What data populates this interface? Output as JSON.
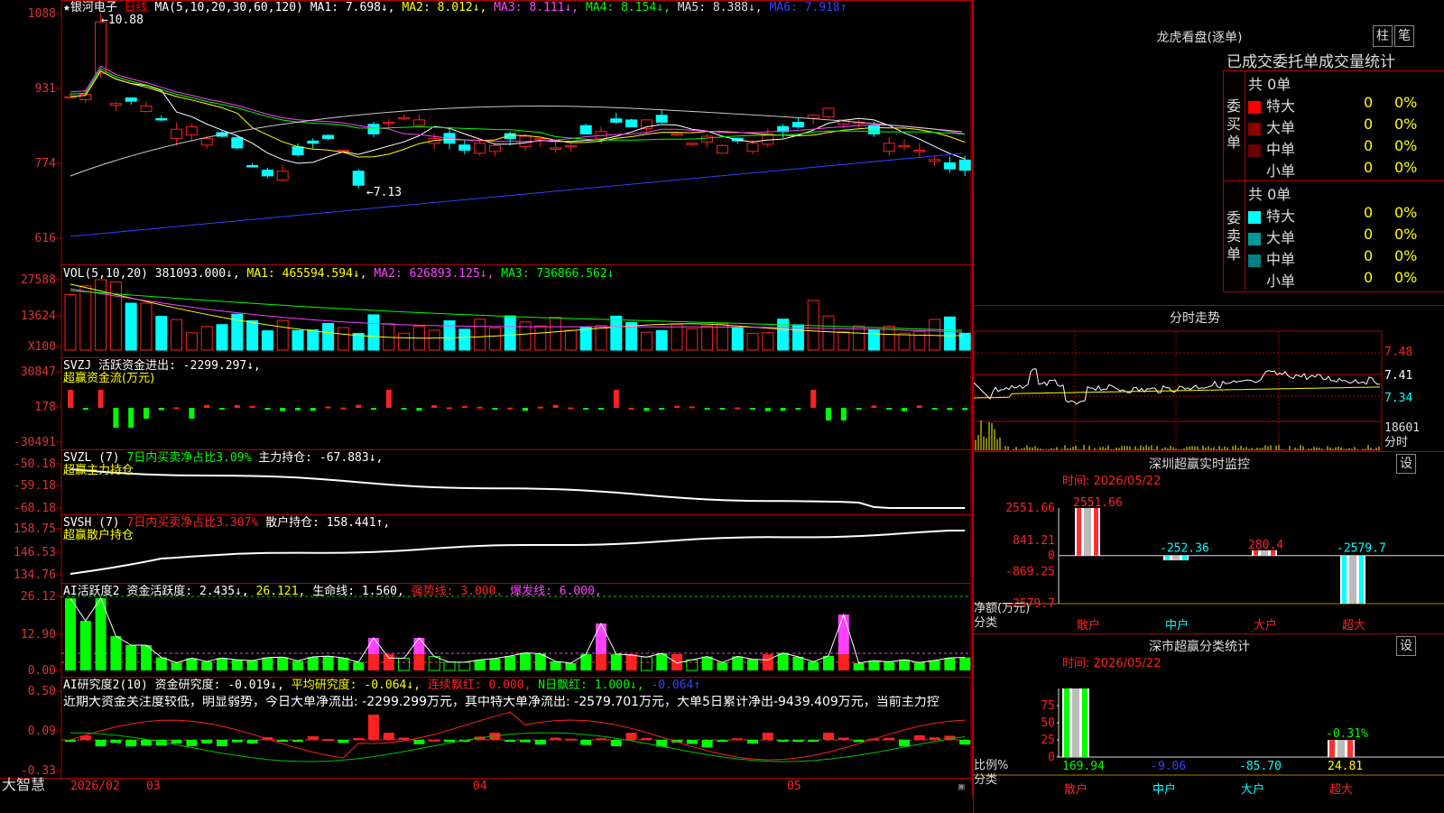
{
  "app": {
    "brand": "大智慧",
    "date_start": "2026/02"
  },
  "main": {
    "title_star": "★",
    "stock_name": "银河电子",
    "period": "日线",
    "ma_def": "MA(5,10,20,30,60,120)",
    "ma1": "MA1: 7.698↓,",
    "ma2": "MA2: 8.012↓,",
    "ma3": "MA3: 8.111↓,",
    "ma4": "MA4: 8.154↓,",
    "ma5": "MA5: 8.388↓,",
    "ma6": "MA6: 7.918↑",
    "high_mark": "10.88",
    "low_mark": "7.13",
    "y_ticks": [
      "1088",
      "931",
      "774",
      "616"
    ]
  },
  "vol": {
    "label": "VOL(5,10,20)",
    "v": "381093.000↓,",
    "ma1": "MA1: 465594.594↓,",
    "ma2": "MA2: 626893.125↓,",
    "ma3": "MA3: 736866.562↓",
    "y_ticks": [
      "27588",
      "13624",
      "X100"
    ]
  },
  "svzj": {
    "label": "SVZJ",
    "text": "活跃资金进出: -2299.297↓,",
    "sub": "超赢资金流(万元)",
    "y_ticks": [
      "30847",
      "178",
      "-30491"
    ]
  },
  "svzl": {
    "label": "SVZL (7)",
    "t1": "7日内买卖净占比3.09%",
    "t2": "主力持仓: -67.883↓,",
    "sub": "超赢主力持仓",
    "y_ticks": [
      "-50.18",
      "-59.18",
      "-68.18"
    ]
  },
  "svsh": {
    "label": "SVSH (7)",
    "t1": "7日内买卖净占比3.307%",
    "t2": "散户持仓: 158.441↑,",
    "sub": "超赢散户持仓",
    "y_ticks": [
      "158.75",
      "146.53",
      "134.76"
    ]
  },
  "ai1": {
    "label": "AI活跃度2",
    "t1": "资金活跃度: 2.435↓,",
    "t2": "26.121,",
    "t3": "生命线: 1.560,",
    "t4": "强势线: 3.000,",
    "t5": "爆发线: 6.000,",
    "y_ticks": [
      "26.12",
      "12.90",
      "0.00"
    ]
  },
  "ai2": {
    "label": "AI研究度2(10)",
    "t1": "资金研究度: -0.019↓,",
    "t2": "平均研究度: -0.064↓,",
    "t3": "连续飘红: 0.000,",
    "t4": "N日飘红: 1.000↓,",
    "t5": "-0.064↑",
    "comment": "近期大资金关注度较低，明显弱势，今日大单净流出: -2299.299万元，其中特大单净流出: -2579.701万元，大单5日累计净出-9439.409万元，当前主力控",
    "y_ticks": [
      "0.50",
      "0.09",
      "-0.33"
    ]
  },
  "axis_months": [
    "03",
    "04",
    "05"
  ],
  "lhb": {
    "title": "龙虎看盘(逐单)",
    "btn1": "柱",
    "btn2": "笔",
    "header": "已成交委托单成交量统计",
    "buy_label": "委买单",
    "sell_label": "委卖单",
    "buy_total": "共 0单",
    "sell_total": "共 0单",
    "rows": [
      "特大",
      "大单",
      "中单",
      "小单"
    ],
    "zero": "0",
    "pct": "0%",
    "buy_colors": [
      "#ff0000",
      "#8b0000",
      "#6a0000",
      ""
    ],
    "sell_colors": [
      "#00ffff",
      "#009999",
      "#008080",
      ""
    ]
  },
  "fenshi": {
    "title": "分时走势",
    "y_ticks": [
      "7.48",
      "7.41",
      "7.34"
    ],
    "vol_tick": "18601",
    "vol_unit": "分时"
  },
  "szm": {
    "title": "深圳超赢实时监控",
    "settings": "设",
    "time": "时间: 2026/05/22",
    "y_ticks": [
      "2551.66",
      "841.21",
      "0",
      "-869.25",
      "-2579.7"
    ],
    "y_title": "净额(万元)",
    "x_title": "分类"
  },
  "szc": {
    "title": "深市超赢分类统计",
    "settings": "设",
    "time": "时间: 2026/05/22",
    "y_ticks": [
      "75",
      "50",
      "25",
      "0"
    ],
    "y_title": "比例%",
    "x_title": "分类"
  },
  "chart_data": [
    {
      "type": "bar",
      "title": "深圳超赢实时监控",
      "ylabel": "净额(万元)",
      "categories": [
        "散户",
        "中户",
        "大户",
        "超大"
      ],
      "values": [
        2551.66,
        -252.36,
        280.4,
        -2579.7
      ],
      "value_labels": [
        "2551.66",
        "-252.36",
        "280.4",
        "-2579.7"
      ],
      "ylim": [
        -2579.7,
        2551.66
      ]
    },
    {
      "type": "bar",
      "title": "深市超赢分类统计",
      "ylabel": "比例%",
      "categories": [
        "散户",
        "中户",
        "大户",
        "超大"
      ],
      "values": [
        169.94,
        -9.06,
        -85.7,
        24.81
      ],
      "value_labels": [
        "169.94",
        "-9.06",
        "-85.70",
        "24.81"
      ],
      "annotation": "-0.31%",
      "ylim": [
        0,
        100
      ]
    }
  ],
  "colors": {
    "up": "#ff2020",
    "down": "#00ffff",
    "grid": "#b00000",
    "white": "#ffffff",
    "yellow": "#ffff00",
    "magenta": "#ff40ff",
    "green": "#00ff00",
    "blue": "#3040ff"
  }
}
